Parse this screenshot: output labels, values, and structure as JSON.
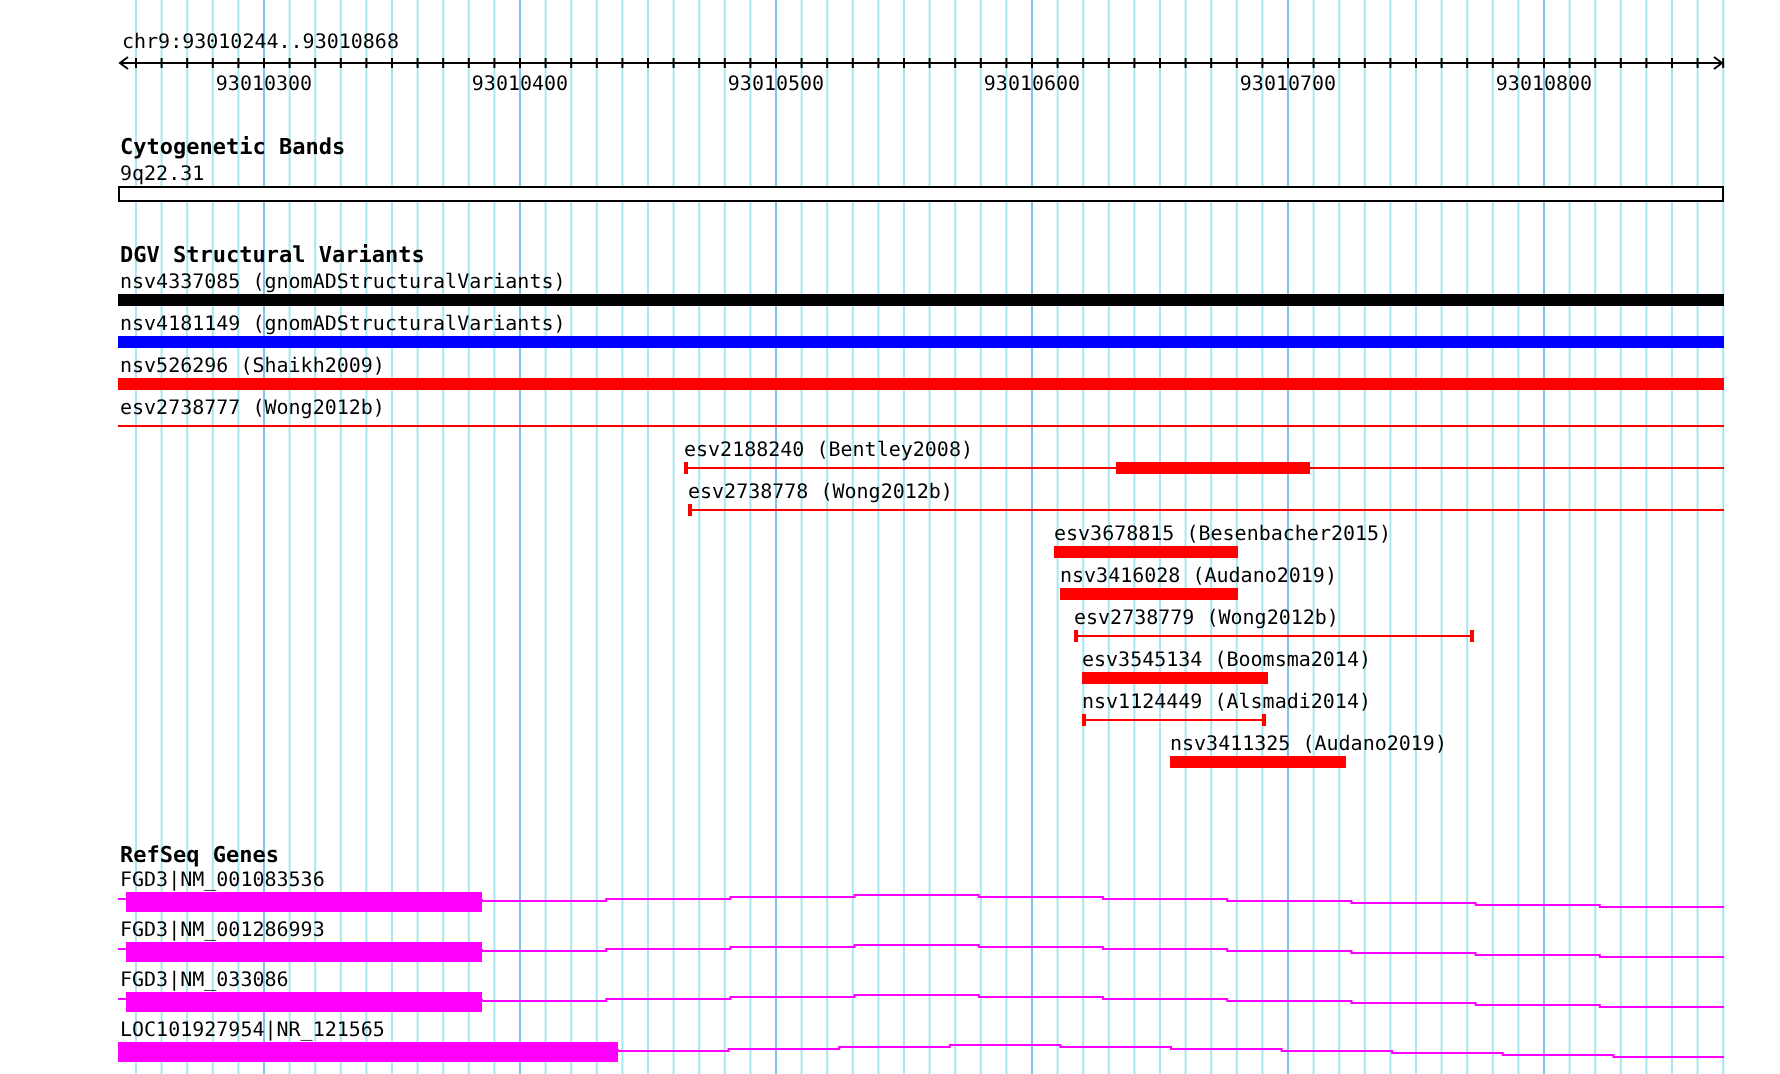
{
  "ruler": {
    "location": "chr9:93010244..93010868",
    "ticks": [
      "93010300",
      "93010400",
      "93010500",
      "93010600",
      "93010700",
      "93010800"
    ]
  },
  "tracks": [
    {
      "title": "Cytogenetic Bands",
      "features": [
        {
          "label": "9q22.31",
          "kind": "band"
        }
      ]
    },
    {
      "title": "DGV Structural Variants",
      "features": [
        {
          "label": "nsv4337085 (gnomADStructuralVariants)",
          "kind": "bar",
          "color": "#000000"
        },
        {
          "label": "nsv4181149 (gnomADStructuralVariants)",
          "kind": "bar",
          "color": "#0000ff"
        },
        {
          "label": "nsv526296 (Shaikh2009)",
          "kind": "bar",
          "color": "#ff0000"
        },
        {
          "label": "esv2738777 (Wong2012b)",
          "kind": "range",
          "color": "#ff0000"
        },
        {
          "label": "esv2188240 (Bentley2008)",
          "kind": "range",
          "color": "#ff0000"
        },
        {
          "label": "esv2738778 (Wong2012b)",
          "kind": "range",
          "color": "#ff0000"
        },
        {
          "label": "esv3678815 (Besenbacher2015)",
          "kind": "bar",
          "color": "#ff0000"
        },
        {
          "label": "nsv3416028 (Audano2019)",
          "kind": "bar",
          "color": "#ff0000"
        },
        {
          "label": "esv2738779 (Wong2012b)",
          "kind": "range",
          "color": "#ff0000"
        },
        {
          "label": "esv3545134 (Boomsma2014)",
          "kind": "bar",
          "color": "#ff0000"
        },
        {
          "label": "nsv1124449 (Alsmadi2014)",
          "kind": "range",
          "color": "#ff0000"
        },
        {
          "label": "nsv3411325 (Audano2019)",
          "kind": "bar",
          "color": "#ff0000"
        }
      ]
    },
    {
      "title": "RefSeq Genes",
      "features": [
        {
          "label": "FGD3|NM_001083536",
          "kind": "gene"
        },
        {
          "label": "FGD3|NM_001286993",
          "kind": "gene"
        },
        {
          "label": "FGD3|NM_033086",
          "kind": "gene"
        },
        {
          "label": "LOC101927954|NR_121565",
          "kind": "gene"
        }
      ]
    }
  ]
}
